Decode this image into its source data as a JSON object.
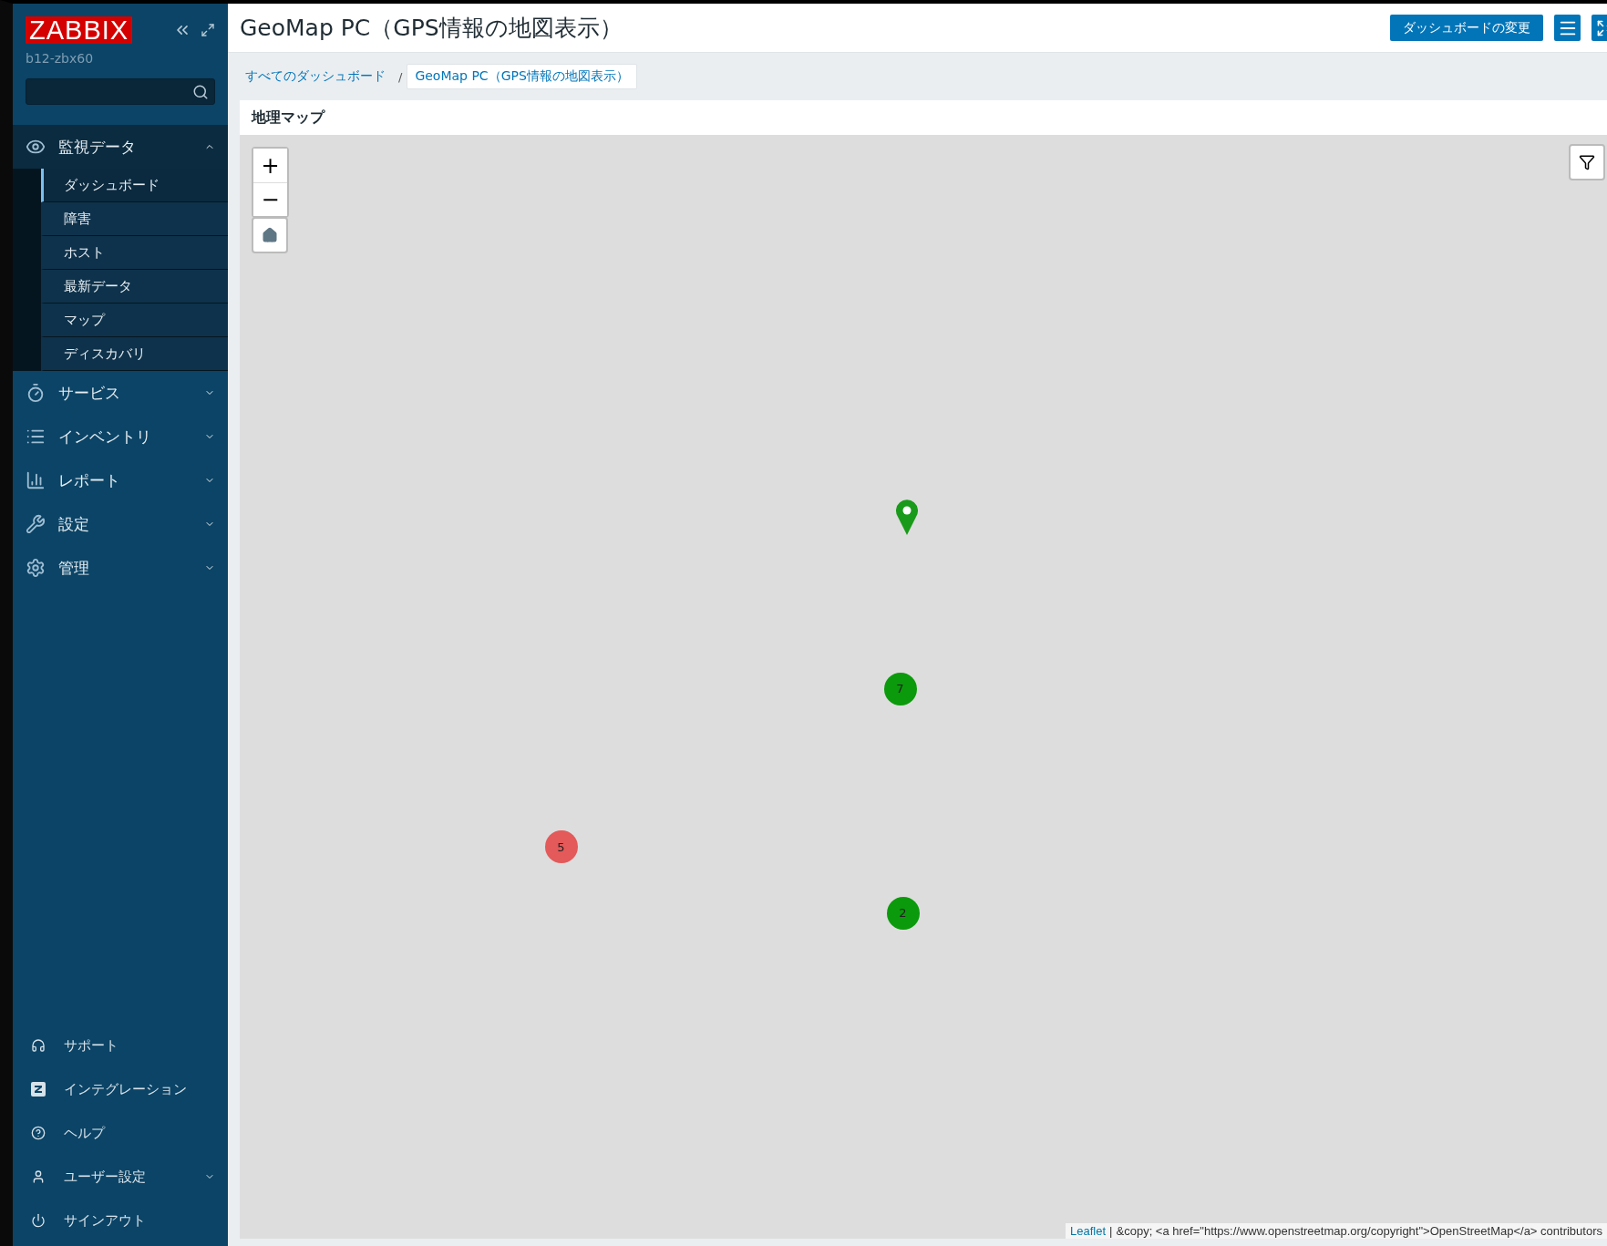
{
  "sidebar": {
    "logo": "ZABBIX",
    "server": "b12-zbx60",
    "menu": [
      {
        "label": "監視データ",
        "expanded": true,
        "children": [
          {
            "label": "ダッシュボード",
            "selected": true
          },
          {
            "label": "障害",
            "selected": false
          },
          {
            "label": "ホスト",
            "selected": false
          },
          {
            "label": "最新データ",
            "selected": false
          },
          {
            "label": "マップ",
            "selected": false
          },
          {
            "label": "ディスカバリ",
            "selected": false
          }
        ]
      },
      {
        "label": "サービス",
        "expanded": false
      },
      {
        "label": "インベントリ",
        "expanded": false
      },
      {
        "label": "レポート",
        "expanded": false
      },
      {
        "label": "設定",
        "expanded": false
      },
      {
        "label": "管理",
        "expanded": false
      }
    ],
    "bottom_menu": [
      {
        "label": "サポート",
        "kind": "link"
      },
      {
        "label": "インテグレーション",
        "kind": "link"
      },
      {
        "label": "ヘルプ",
        "kind": "link"
      },
      {
        "label": "ユーザー設定",
        "kind": "submenu"
      },
      {
        "label": "サインアウト",
        "kind": "link"
      }
    ]
  },
  "header": {
    "title": "GeoMap PC（GPS情報の地図表示）",
    "edit_button": "ダッシュボードの変更"
  },
  "breadcrumbs": [
    {
      "label": "すべてのダッシュボード",
      "selected": false
    },
    {
      "label": "GeoMap PC（GPS情報の地図表示）",
      "selected": true
    }
  ],
  "breadcrumb_separator": "/",
  "widget": {
    "title": "地理マップ",
    "zoom_in": "+",
    "zoom_out": "−",
    "markers": [
      {
        "kind": "pin",
        "color": "#1a9a1a"
      },
      {
        "kind": "cluster",
        "label": "7",
        "color": "#0b9a0b"
      },
      {
        "kind": "cluster",
        "label": "5",
        "color": "#e45959"
      },
      {
        "kind": "cluster",
        "label": "2",
        "color": "#0b9a0b"
      }
    ],
    "attribution": {
      "link": "Leaflet",
      "separator": "|",
      "text": "&copy; <a href=\"https://www.openstreetmap.org/copyright\">OpenStreetMap</a> contributors"
    }
  }
}
